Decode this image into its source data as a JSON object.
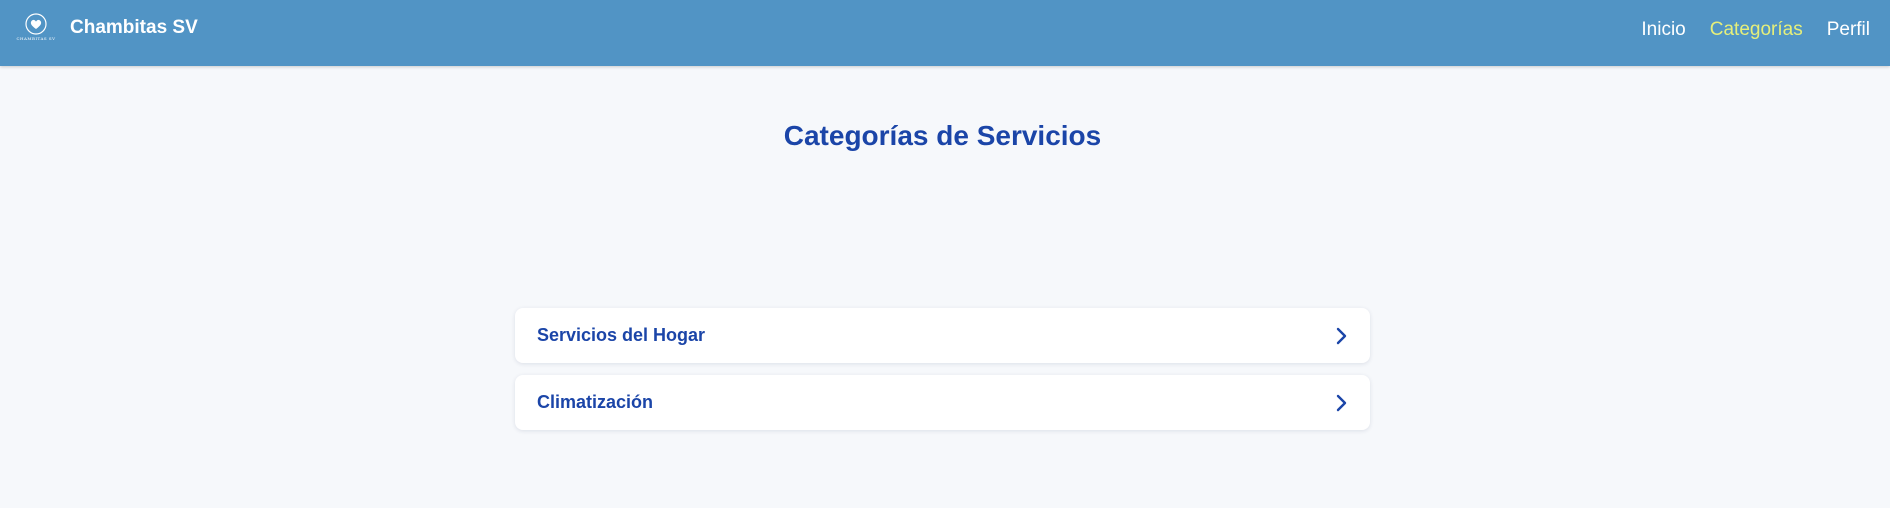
{
  "header": {
    "logo_text": "CHAMBITAS SV",
    "brand": "Chambitas SV",
    "nav": [
      {
        "label": "Inicio"
      },
      {
        "label": "Categorías"
      },
      {
        "label": "Perfil"
      }
    ]
  },
  "main": {
    "title": "Categorías de Servicios",
    "categories": [
      {
        "label": "Servicios del Hogar",
        "icon": "chevron-right-icon"
      },
      {
        "label": "Climatización",
        "icon": "chevron-right-icon"
      }
    ]
  },
  "colors": {
    "navbar": "#5194c5",
    "accent_text": "#1b45a8",
    "active_nav": "#e6ef7a",
    "background": "#f6f8fb"
  }
}
